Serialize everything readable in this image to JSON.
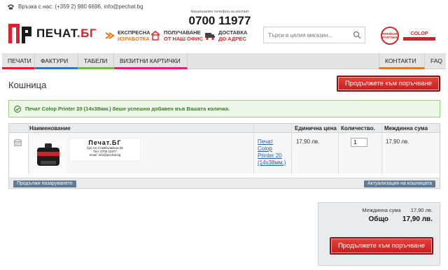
{
  "contact": {
    "text": "Връзка с нас: (+359 2) 980 6696, info@pechat.bg"
  },
  "logo": {
    "name": "ПЕЧАТ",
    "suffix": ".БГ"
  },
  "hotline": {
    "caption": "Национален телефон за контакт",
    "number": "0700 11977"
  },
  "features": [
    {
      "line1": "ЕКСПРЕСНА",
      "line2": "ИЗРАБОТКА",
      "icon": "speed-icon"
    },
    {
      "line1": "ПОЛУЧАВАНЕ",
      "line2": "ОТ НАШ ОФИС",
      "icon": "office-icon"
    },
    {
      "line1": "ДОСТАВКА",
      "line2": "ДО АДРЕС",
      "icon": "truck-icon"
    }
  ],
  "search": {
    "placeholder": "Търси в целия магазин..."
  },
  "badges": {
    "round": "PREMIUM PARTNER",
    "colop": "COLOP"
  },
  "nav": {
    "items": [
      "ПЕЧАТИ",
      "ФАКТУРИ",
      "ТАБЕЛИ",
      "ВИЗИТНИ КАРТИЧКИ",
      "КОНТАКТИ",
      "FAQ"
    ]
  },
  "page": {
    "title": "Кошница",
    "checkout_label": "Продължете към поръчване"
  },
  "message": {
    "success": "Печат Colop Printer 20 (14x38мм.) беше успешно добавен във Вашата количка."
  },
  "cart": {
    "headers": {
      "name": "Наименование",
      "unit_price": "Единична цена",
      "quantity": "Количество.",
      "subtotal": "Междинна сума"
    },
    "item": {
      "product_link": "Печат Colop Printer 20 (14x38мм.)",
      "unit_price": "17,90 лв.",
      "quantity": "1",
      "subtotal": "17,90 лв.",
      "preview": {
        "title": "Печат.БГ",
        "line1": "бул.Ал.Стамболийски 35",
        "line2": "Тел: 0700 11977",
        "line3": "email: info@pechat.bg"
      }
    },
    "continue_label": "Продължи пазаруването",
    "update_label": "Актуализация на кошницата"
  },
  "totals": {
    "subtotal_label": "Междинна сума",
    "subtotal_value": "17,90 лв.",
    "total_label": "Общо",
    "total_value": "17,90 лв.",
    "checkout_label": "Продължете към поръчване"
  },
  "colors": {
    "brand_red": "#e0202a",
    "accent_orange": "#e57a16",
    "link_blue": "#1f5fa8",
    "success_green": "#3a7a2a"
  }
}
